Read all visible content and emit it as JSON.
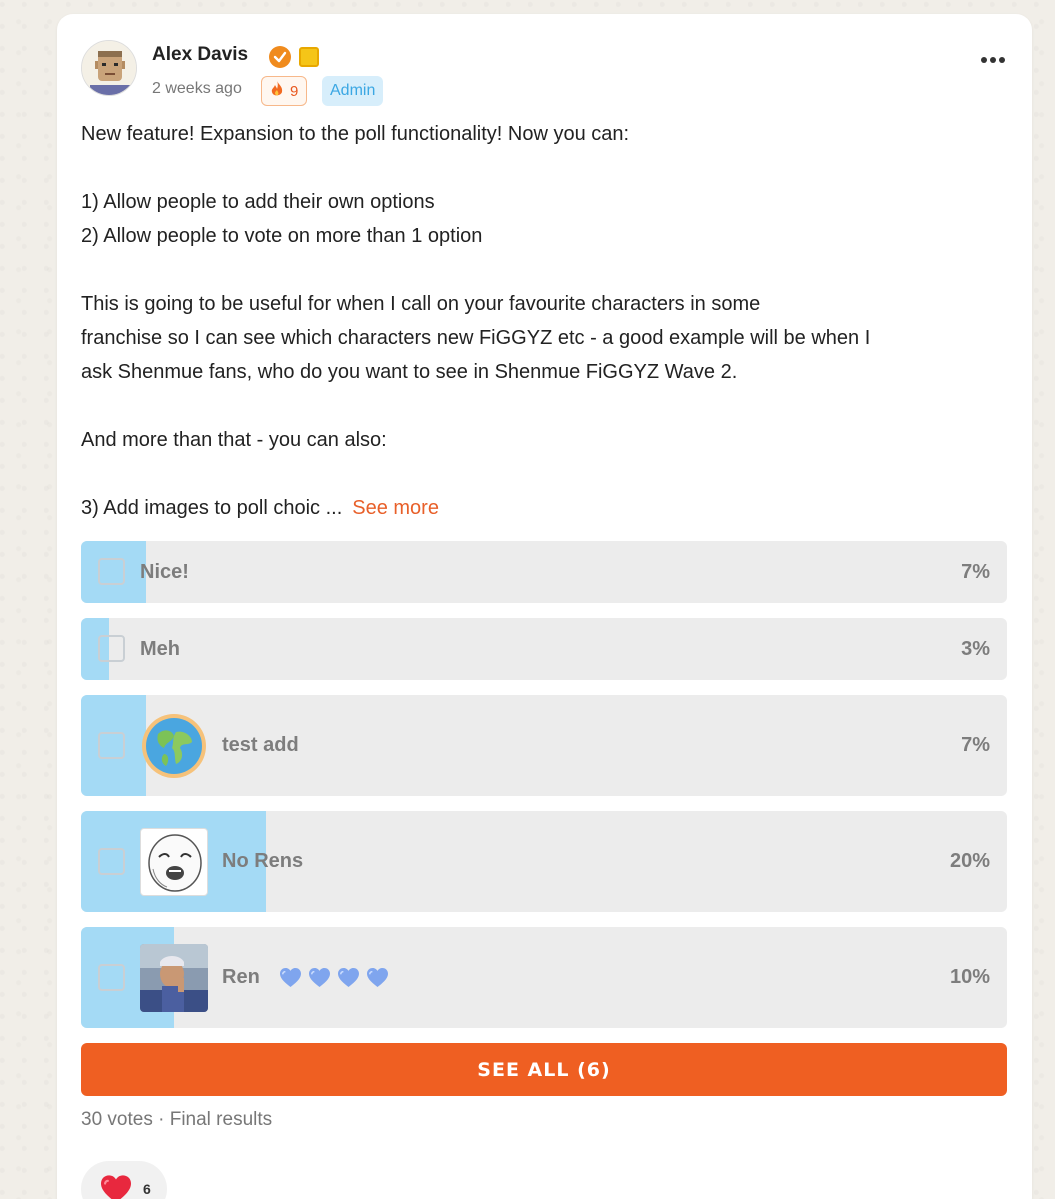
{
  "post": {
    "author": "Alex Davis",
    "timestamp": "2 weeks ago",
    "streak_count": "9",
    "role_badge": "Admin",
    "body_lines": [
      "New feature! Expansion to the poll functionality! Now you can:",
      "1) Allow people to add their own options",
      "2) Allow people to vote on more than 1 option",
      "This is going to be useful for when I call on your favourite characters in some",
      "franchise so I can see which characters new FiGGYZ etc - a good example will be when I",
      "ask Shenmue fans, who do you want to see in Shenmue FiGGYZ Wave 2.",
      "And more than that - you can also:",
      "3) Add images to poll choic ..."
    ],
    "see_more_label": "See more"
  },
  "poll": {
    "options": [
      {
        "label": "Nice!",
        "percent": "7%",
        "fill": 0.07
      },
      {
        "label": "Meh",
        "percent": "3%",
        "fill": 0.03
      },
      {
        "label": "test add",
        "percent": "7%",
        "fill": 0.07,
        "image": "globe-icon"
      },
      {
        "label": "No Rens",
        "percent": "20%",
        "fill": 0.2,
        "image": "meme-face-image"
      },
      {
        "label": "Ren",
        "percent": "10%",
        "fill": 0.1,
        "image": "ren-photo",
        "suffix_icons": [
          "blue-heart-icon",
          "blue-heart-icon",
          "blue-heart-icon",
          "blue-heart-icon"
        ]
      }
    ],
    "see_all_label": "SEE ALL (6)",
    "meta": "30 votes · Final results"
  },
  "reactions": {
    "heart_count": "6"
  },
  "colors": {
    "accent": "#ef5f22",
    "poll_fill": "#a4daf5",
    "admin_badge_bg": "#d7eefb",
    "admin_badge_text": "#3ba7e3"
  }
}
